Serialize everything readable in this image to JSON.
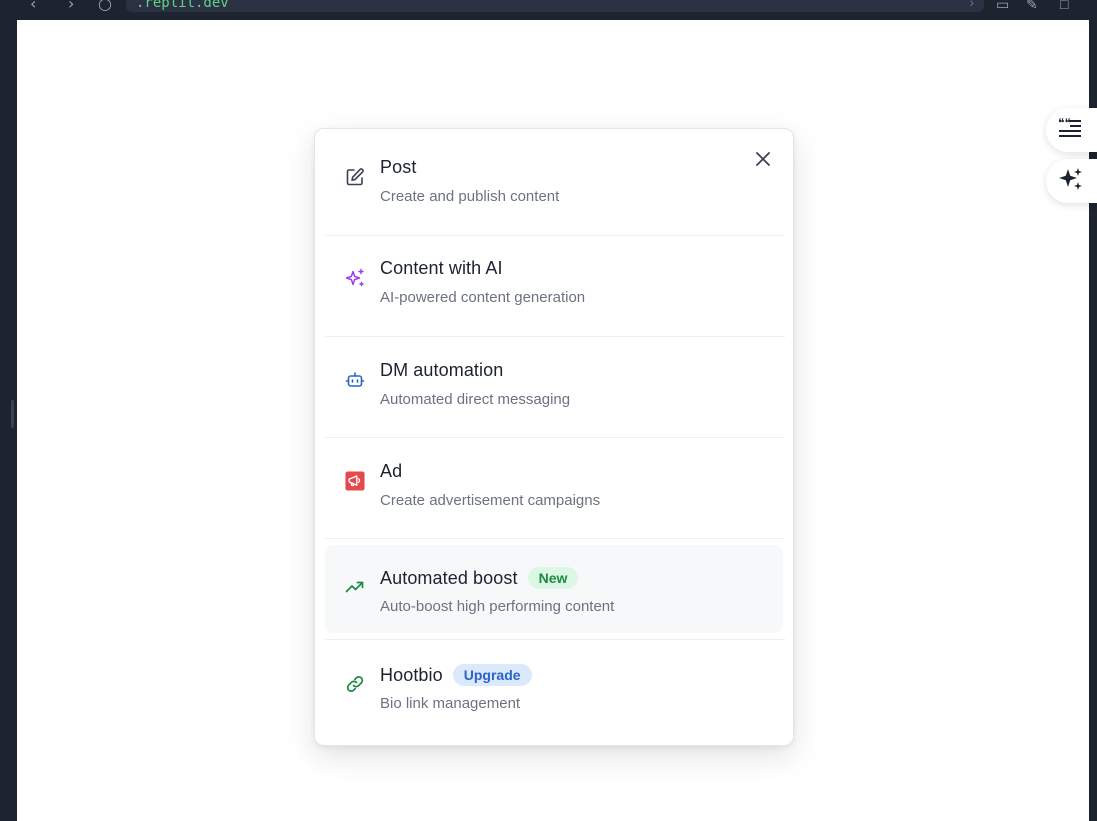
{
  "browser": {
    "url": ".replit.dev"
  },
  "modal": {
    "items": [
      {
        "title": "Post",
        "description": "Create and publish content",
        "icon": "edit-icon"
      },
      {
        "title": "Content with AI",
        "description": "AI-powered content generation",
        "icon": "sparkles-icon"
      },
      {
        "title": "DM automation",
        "description": "Automated direct messaging",
        "icon": "bot-icon"
      },
      {
        "title": "Ad",
        "description": "Create advertisement campaigns",
        "icon": "megaphone-icon"
      },
      {
        "title": "Automated boost",
        "description": "Auto-boost high performing content",
        "icon": "trending-up-icon",
        "badge": "New"
      },
      {
        "title": "Hootbio",
        "description": "Bio link management",
        "icon": "link-icon",
        "badge": "Upgrade"
      }
    ]
  },
  "colors": {
    "ai_icon": "#9b3ff0",
    "dm_icon": "#2b64c7",
    "ad_icon_bg": "#e5484d",
    "boost_icon": "#1d8a44",
    "hootbio_icon": "#1d8a44"
  }
}
